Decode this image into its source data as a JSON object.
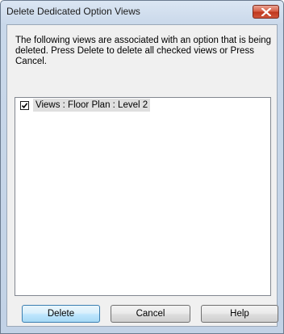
{
  "window": {
    "title": "Delete Dedicated Option Views",
    "close_icon": "close-icon"
  },
  "message": "The following views are associated with an option that is being deleted.  Press Delete to delete all checked views or Press Cancel.",
  "list": {
    "items": [
      {
        "label": "Views : Floor Plan : Level 2",
        "checked": true
      }
    ]
  },
  "buttons": {
    "delete": "Delete",
    "cancel": "Cancel",
    "help": "Help"
  },
  "colors": {
    "close_button": "#c7402a",
    "default_button_border": "#3c7fb1",
    "selection_background": "#dfdfdf"
  }
}
